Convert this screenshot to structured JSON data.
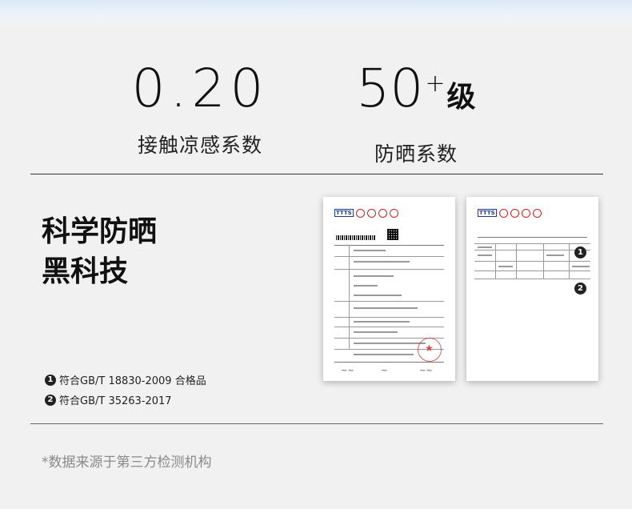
{
  "stats": [
    {
      "value": "0.20",
      "label": "接触凉感系数"
    },
    {
      "value": "50",
      "sup": "+",
      "unit": "级",
      "label": "防晒系数"
    }
  ],
  "headline": {
    "line1": "科学防晒",
    "line2": "黑科技"
  },
  "notes": [
    {
      "num": "1",
      "text": "符合GB/T 18830-2009 合格品"
    },
    {
      "num": "2",
      "text": "符合GB/T 35263-2017"
    }
  ],
  "footnote": "*数据来源于第三方检测机构",
  "colors": {
    "background": "#f1f1f1",
    "text": "#1a1a1a",
    "muted": "#8a8a8a",
    "badge": "#222222"
  }
}
